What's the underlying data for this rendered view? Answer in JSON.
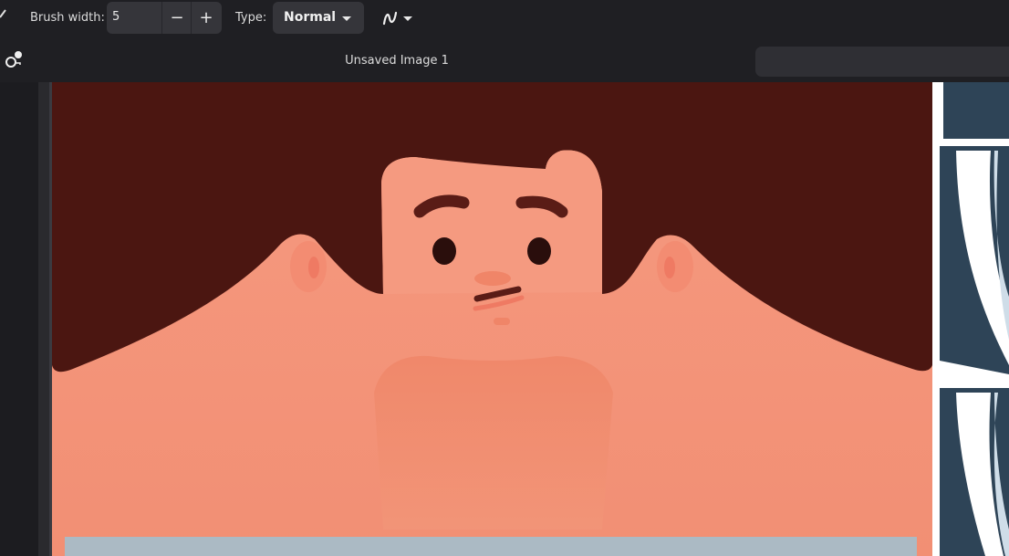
{
  "toolbar": {
    "brush_width_label": "Brush width:",
    "brush_width_value": "5",
    "decrease_symbol": "−",
    "increase_symbol": "+",
    "type_label": "Type:",
    "type_value": "Normal"
  },
  "document": {
    "title": "Unsaved Image 1"
  },
  "colors": {
    "background": "#1c1c20",
    "toolbar": "#1f1f23",
    "control": "#35353a",
    "hair": "#4a1612",
    "skin": "#f29479",
    "shirt": "#abbac4",
    "navy": "#2e4457"
  },
  "icons": [
    "brush-tool-icon",
    "curve-style-icon",
    "layers-tool-icon",
    "chevron-down-icon"
  ]
}
